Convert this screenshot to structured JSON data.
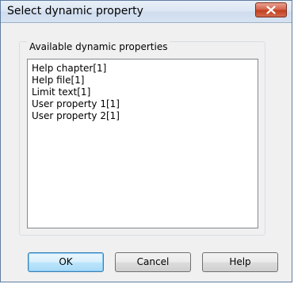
{
  "window": {
    "title": "Select dynamic property"
  },
  "group": {
    "label": "Available dynamic properties",
    "items": [
      "Help chapter[1]",
      "Help file[1]",
      "Limit text[1]",
      "User property 1[1]",
      "User property 2[1]"
    ]
  },
  "buttons": {
    "ok": "OK",
    "cancel": "Cancel",
    "help": "Help"
  },
  "colors": {
    "close_button": "#c2401f",
    "default_button_border": "#3c7fb1"
  }
}
